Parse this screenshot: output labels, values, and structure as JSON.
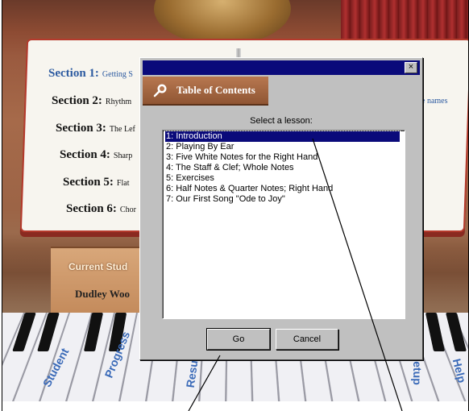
{
  "background": {
    "sections": [
      {
        "number": "Section 1:",
        "title": "Getting S"
      },
      {
        "number": "Section 2:",
        "title": "Rhythm"
      },
      {
        "number": "Section 3:",
        "title": "The Lef"
      },
      {
        "number": "Section 4:",
        "title": "Sharp"
      },
      {
        "number": "Section 5:",
        "title": "Flat"
      },
      {
        "number": "Section 6:",
        "title": "Chor"
      }
    ],
    "right_page_text": "e names",
    "panel_label": "Current Stud",
    "student_name": "Dudley Woo",
    "piano_labels": [
      "Student",
      "Progress",
      "Resu",
      "etup",
      "Help"
    ]
  },
  "dialog": {
    "close_label": "×",
    "header": "Table of Contents",
    "prompt": "Select a lesson:",
    "lessons": [
      "1: Introduction",
      "2: Playing By Ear",
      "3: Five White Notes for the Right Hand",
      "4: The Staff & Clef; Whole Notes",
      "5: Exercises",
      "6: Half Notes & Quarter Notes;  Right Hand",
      "7: Our First Song \"Ode to Joy\""
    ],
    "selected_index": 0,
    "go_label": "Go",
    "cancel_label": "Cancel"
  },
  "colors": {
    "titlebar": "#0a0a7a",
    "selection": "#0a0a7a",
    "dialog_face": "#c0c0c0",
    "toc_header": "#9a603c"
  }
}
